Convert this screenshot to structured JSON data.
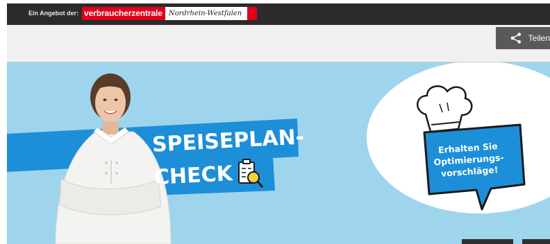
{
  "top_bar": {
    "offer_label": "Ein Angebot der:",
    "brand_red": "verbraucherzentrale",
    "brand_region": "Nordrhein-Westfalen"
  },
  "sub_bar": {
    "share_label": "Teilen",
    "share_icon": "share-icon"
  },
  "hero": {
    "title_line1": "SPEISEPLAN-",
    "title_line2": "CHECK",
    "bubble_lines": [
      "Erhalten Sie",
      "Optimierungs-",
      "vorschläge!"
    ],
    "icons": [
      "checklist-magnifier-icon",
      "chef-hat-icon"
    ]
  },
  "colors": {
    "top_bar": "#2b2b2b",
    "brand_red": "#e1001a",
    "hero_bg": "#9fd4ed",
    "ribbon_blue": "#1d8ed8",
    "share_button": "#595959"
  }
}
